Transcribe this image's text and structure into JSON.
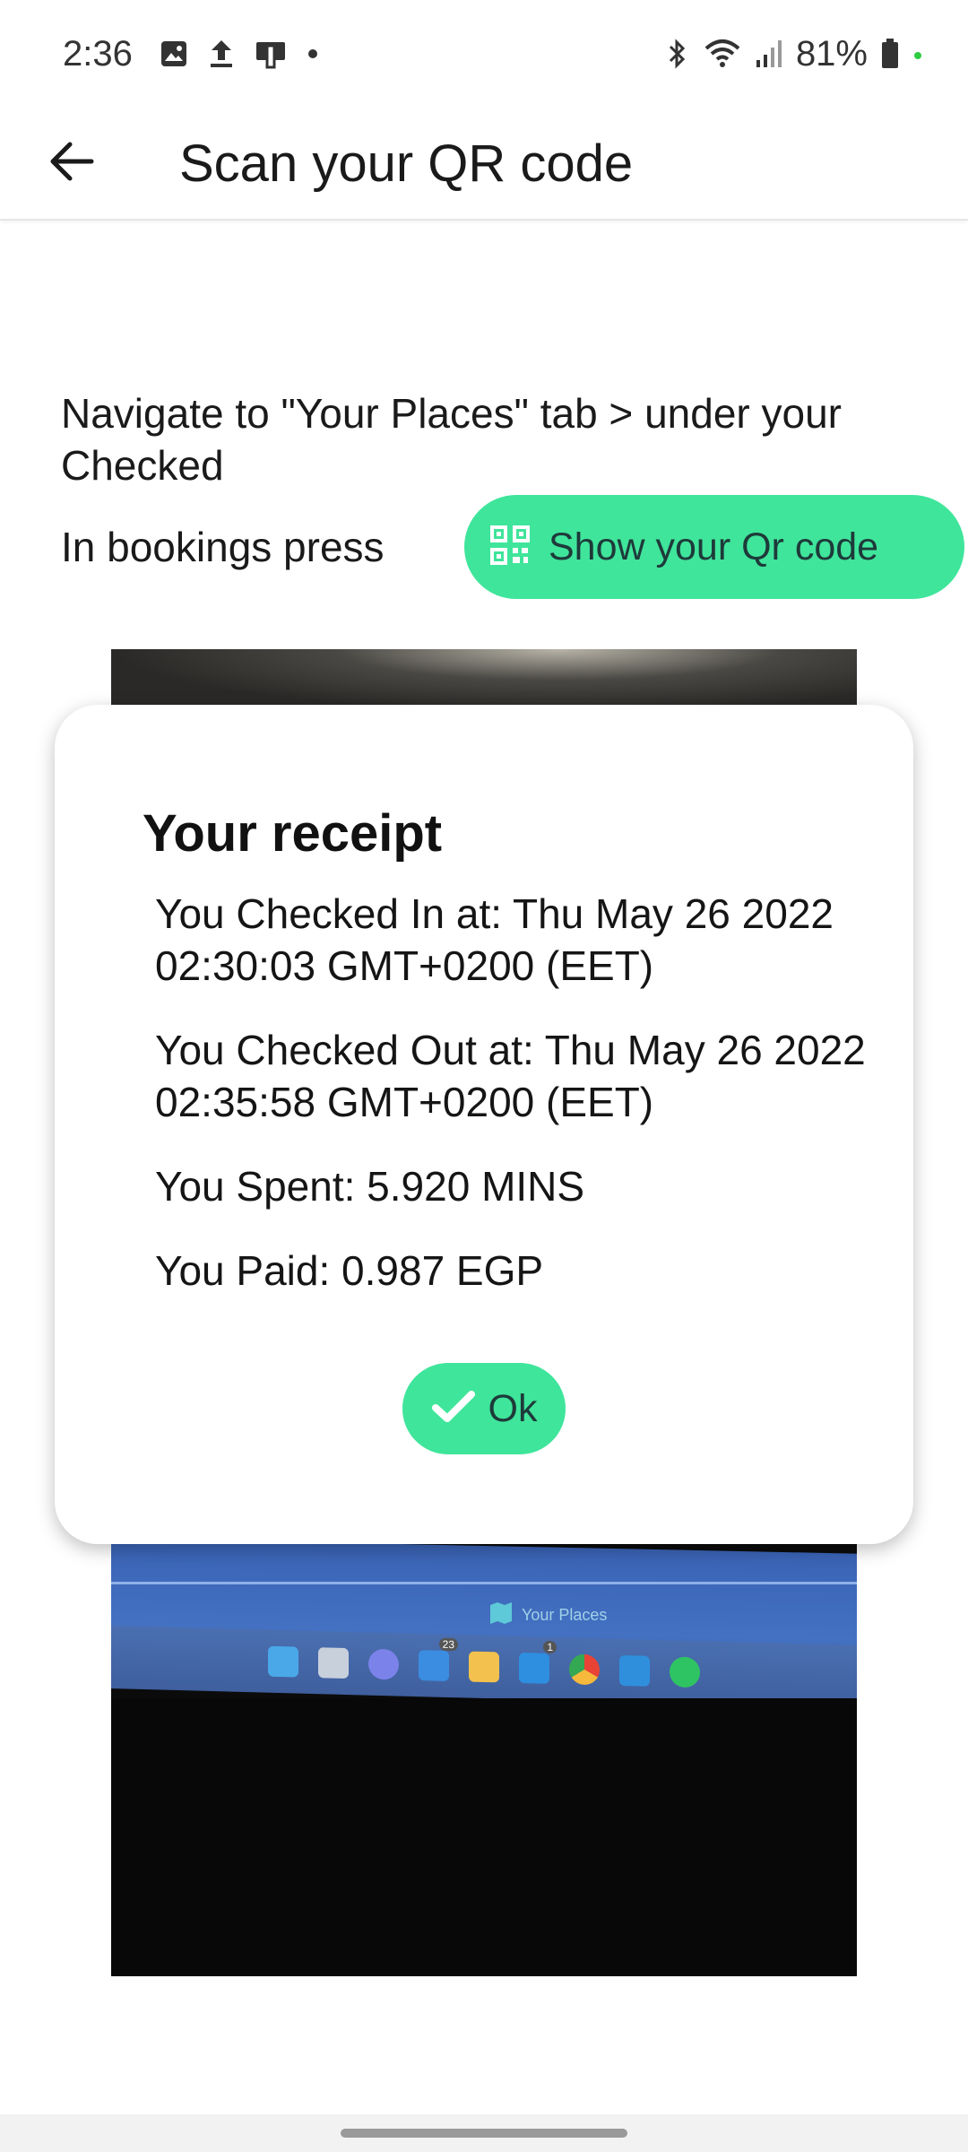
{
  "status_bar": {
    "time": "2:36",
    "battery": "81%",
    "left_icons": [
      "gallery-icon",
      "upload-icon",
      "device-icon",
      "dot-icon"
    ],
    "right_icons": [
      "bluetooth-icon",
      "wifi-icon",
      "signal-icon",
      "battery-icon"
    ]
  },
  "app_bar": {
    "title": "Scan your QR code",
    "back_icon": "arrow-back-icon"
  },
  "instructions": {
    "line1": "Navigate to \"Your Places\" tab > under your Checked",
    "line2": "In bookings press",
    "qr_button_label": "Show your Qr code",
    "qr_icon": "qr-code-icon"
  },
  "camera": {
    "overlay_text": "Your Places",
    "badge_1": "23",
    "badge_2": "1"
  },
  "dialog": {
    "title": "Your receipt",
    "checked_in": "You Checked In at: Thu May 26 2022 02:30:03 GMT+0200 (EET)",
    "checked_out": "You Checked Out at: Thu May 26 2022 02:35:58 GMT+0200 (EET)",
    "spent": "You Spent: 5.920 MINS",
    "paid": "You Paid: 0.987 EGP",
    "ok_label": "Ok"
  },
  "colors": {
    "accent": "#3fe59b",
    "button_text": "#1e3a3a"
  }
}
